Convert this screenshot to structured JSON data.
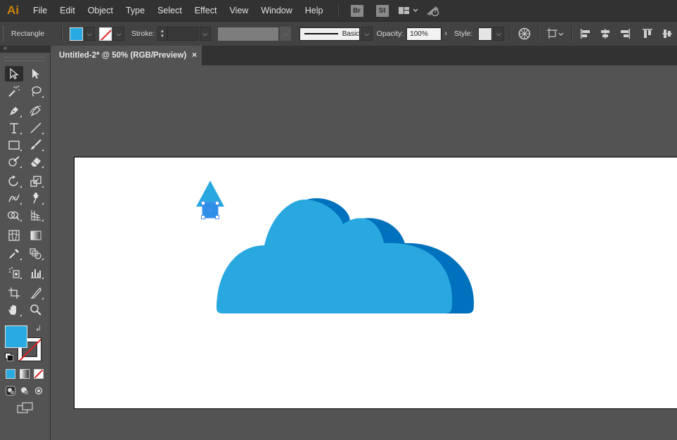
{
  "app": {
    "logo": "Ai"
  },
  "menu": [
    "File",
    "Edit",
    "Object",
    "Type",
    "Select",
    "Effect",
    "View",
    "Window",
    "Help"
  ],
  "menubar_icons": {
    "bridge": "Br",
    "stock": "St",
    "workspace": "workspace-switcher-icon",
    "gpu": "gpu-performance-icon"
  },
  "control": {
    "tool_name": "Rectangle",
    "stroke_label": "Stroke:",
    "brush_label": "Basic",
    "opacity_label": "Opacity:",
    "opacity_value": "100%",
    "style_label": "Style:"
  },
  "document": {
    "tab_title": "Untitled-2* @ 50% (RGB/Preview)",
    "close": "×"
  },
  "colors": {
    "fill": "#29abe2",
    "stroke": "none",
    "cloud_light": "#29a8e0",
    "cloud_dark": "#0071bc",
    "arrow": "#29a8e0",
    "selection": "#4a8ef0"
  },
  "tools": [
    "selection-tool",
    "direct-selection-tool",
    "magic-wand-tool",
    "lasso-tool",
    "pen-tool",
    "curvature-tool",
    "type-tool",
    "line-segment-tool",
    "rectangle-tool",
    "paintbrush-tool",
    "shaper-tool",
    "eraser-tool",
    "rotate-tool",
    "scale-tool",
    "width-tool",
    "puppet-warp-tool",
    "shape-builder-tool",
    "perspective-grid-tool",
    "mesh-tool",
    "gradient-tool",
    "eyedropper-tool",
    "blend-tool",
    "symbol-sprayer-tool",
    "column-graph-tool",
    "artboard-tool",
    "slice-tool",
    "hand-tool",
    "zoom-tool"
  ],
  "panel_toggle": "«"
}
